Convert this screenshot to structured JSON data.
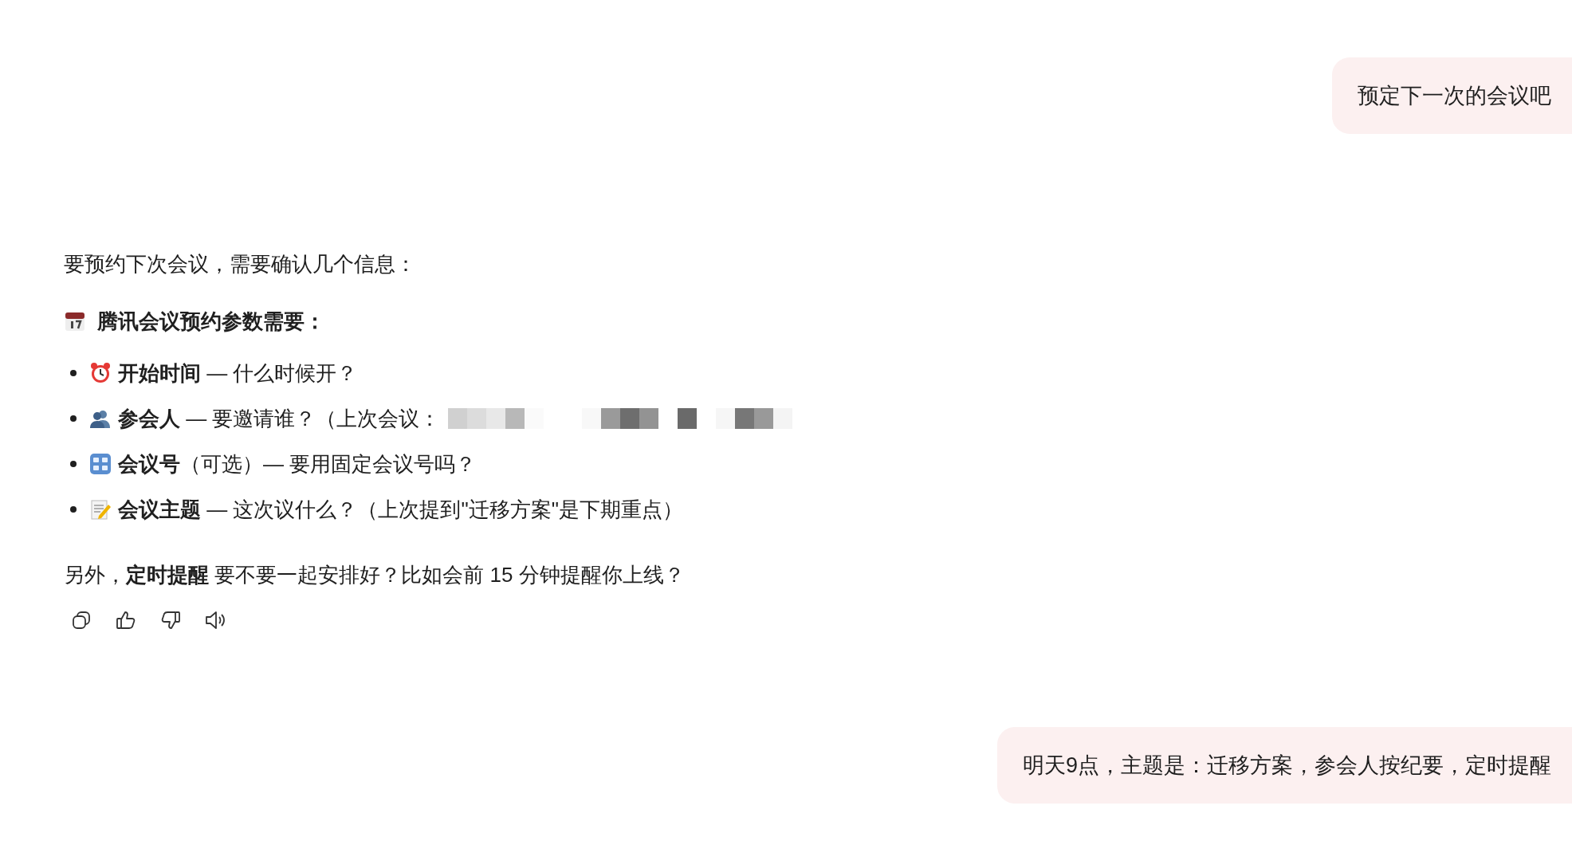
{
  "messages": [
    {
      "kind": "user",
      "text": "预定下一次的会议吧"
    },
    {
      "kind": "answer",
      "intro": "要预约下次会议，需要确认几个信息：",
      "heading": "腾讯会议预约参数需要：",
      "items": [
        {
          "text": "**开始时间** — 什么时候开？",
          "redacted": false
        },
        {
          "text": "**参会人** — 要邀请谁？（上次会议：",
          "redacted": true
        },
        {
          "text": "**会议号**（可选）— 要用固定会议号吗？",
          "redacted": false
        },
        {
          "text": "**会议主题** — 这次议什么？（上次提到\"迁移方案\"是下期重点）",
          "redacted": false
        }
      ],
      "outro": "另外，**定时提醒** 要不要一起安排好？比如会前 15 分钟提醒你上线？"
    },
    {
      "kind": "user",
      "text": "明天9点，主题是：迁移方案，参会人按纪要，定时提醒"
    }
  ]
}
